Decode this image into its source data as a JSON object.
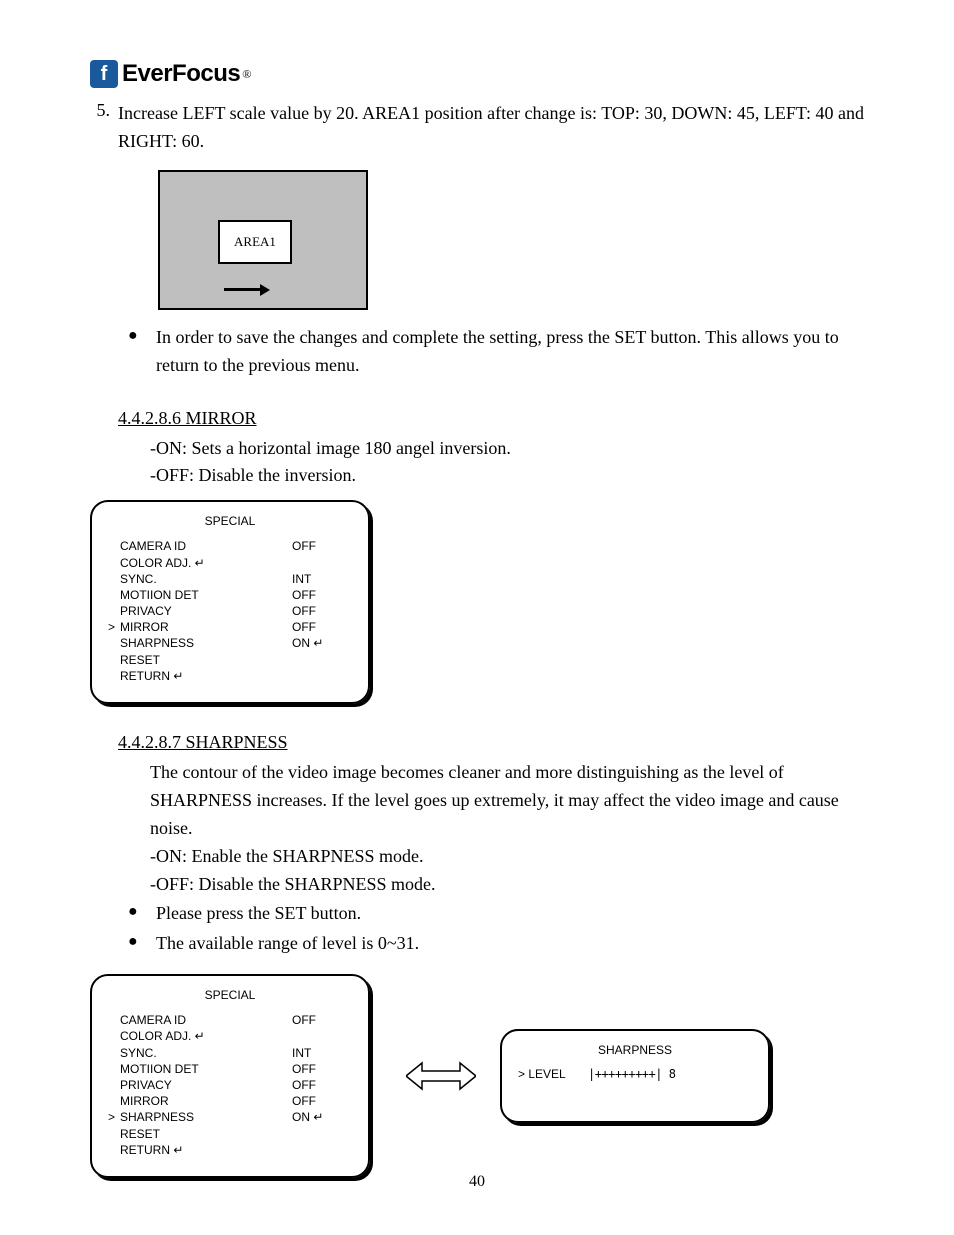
{
  "logo": {
    "text": "EverFocus",
    "reg": "®"
  },
  "item5": {
    "num": "5.",
    "text": "Increase LEFT scale value by 20. AREA1 position after change is: TOP: 30, DOWN: 45, LEFT: 40 and RIGHT: 60."
  },
  "area_fig": {
    "label": "AREA1"
  },
  "bullet_save": "In order to save the changes and complete the setting, press the SET button. This allows you to return to the previous menu.",
  "mirror": {
    "heading": "4.4.2.8.6 MIRROR",
    "line_on": "-ON: Sets a horizontal image 180 angel inversion.",
    "line_off": "-OFF: Disable the inversion."
  },
  "osd1": {
    "title": "SPECIAL",
    "rows": [
      {
        "cursor": "",
        "label": "CAMERA ID",
        "val": "OFF"
      },
      {
        "cursor": "",
        "label": "COLOR ADJ. ↵",
        "val": ""
      },
      {
        "cursor": "",
        "label": "SYNC.",
        "val": "INT"
      },
      {
        "cursor": "",
        "label": "MOTIION DET",
        "val": "OFF"
      },
      {
        "cursor": "",
        "label": "PRIVACY",
        "val": "OFF"
      },
      {
        "cursor": ">",
        "label": "MIRROR",
        "val": "OFF"
      },
      {
        "cursor": "",
        "label": "SHARPNESS",
        "val": "ON ↵"
      },
      {
        "cursor": "",
        "label": "RESET",
        "val": ""
      },
      {
        "cursor": "",
        "label": "RETURN ↵",
        "val": ""
      }
    ]
  },
  "sharp": {
    "heading": "4.4.2.8.7 SHARPNESS",
    "desc": "The contour of the video image becomes cleaner and more distinguishing as the level of SHARPNESS increases. If the level goes up extremely, it may affect the video image and cause noise.",
    "line_on": "-ON: Enable the SHARPNESS mode.",
    "line_off": "-OFF: Disable the SHARPNESS mode.",
    "bullet1": "Please press the SET button.",
    "bullet2": "The available range of level is 0~31."
  },
  "osd2": {
    "title": "SPECIAL",
    "rows": [
      {
        "cursor": "",
        "label": "CAMERA ID",
        "val": "OFF"
      },
      {
        "cursor": "",
        "label": "COLOR ADJ. ↵",
        "val": ""
      },
      {
        "cursor": "",
        "label": "SYNC.",
        "val": "INT"
      },
      {
        "cursor": "",
        "label": "MOTIION DET",
        "val": "OFF"
      },
      {
        "cursor": "",
        "label": "PRIVACY",
        "val": "OFF"
      },
      {
        "cursor": "",
        "label": "MIRROR",
        "val": "OFF"
      },
      {
        "cursor": ">",
        "label": "SHARPNESS",
        "val": "ON ↵"
      },
      {
        "cursor": "",
        "label": "RESET",
        "val": ""
      },
      {
        "cursor": "",
        "label": "RETURN ↵",
        "val": ""
      }
    ]
  },
  "osd3": {
    "title": "SHARPNESS",
    "level_label": "> LEVEL",
    "level_bar": "|+++++++++| 8"
  },
  "page_number": "40"
}
